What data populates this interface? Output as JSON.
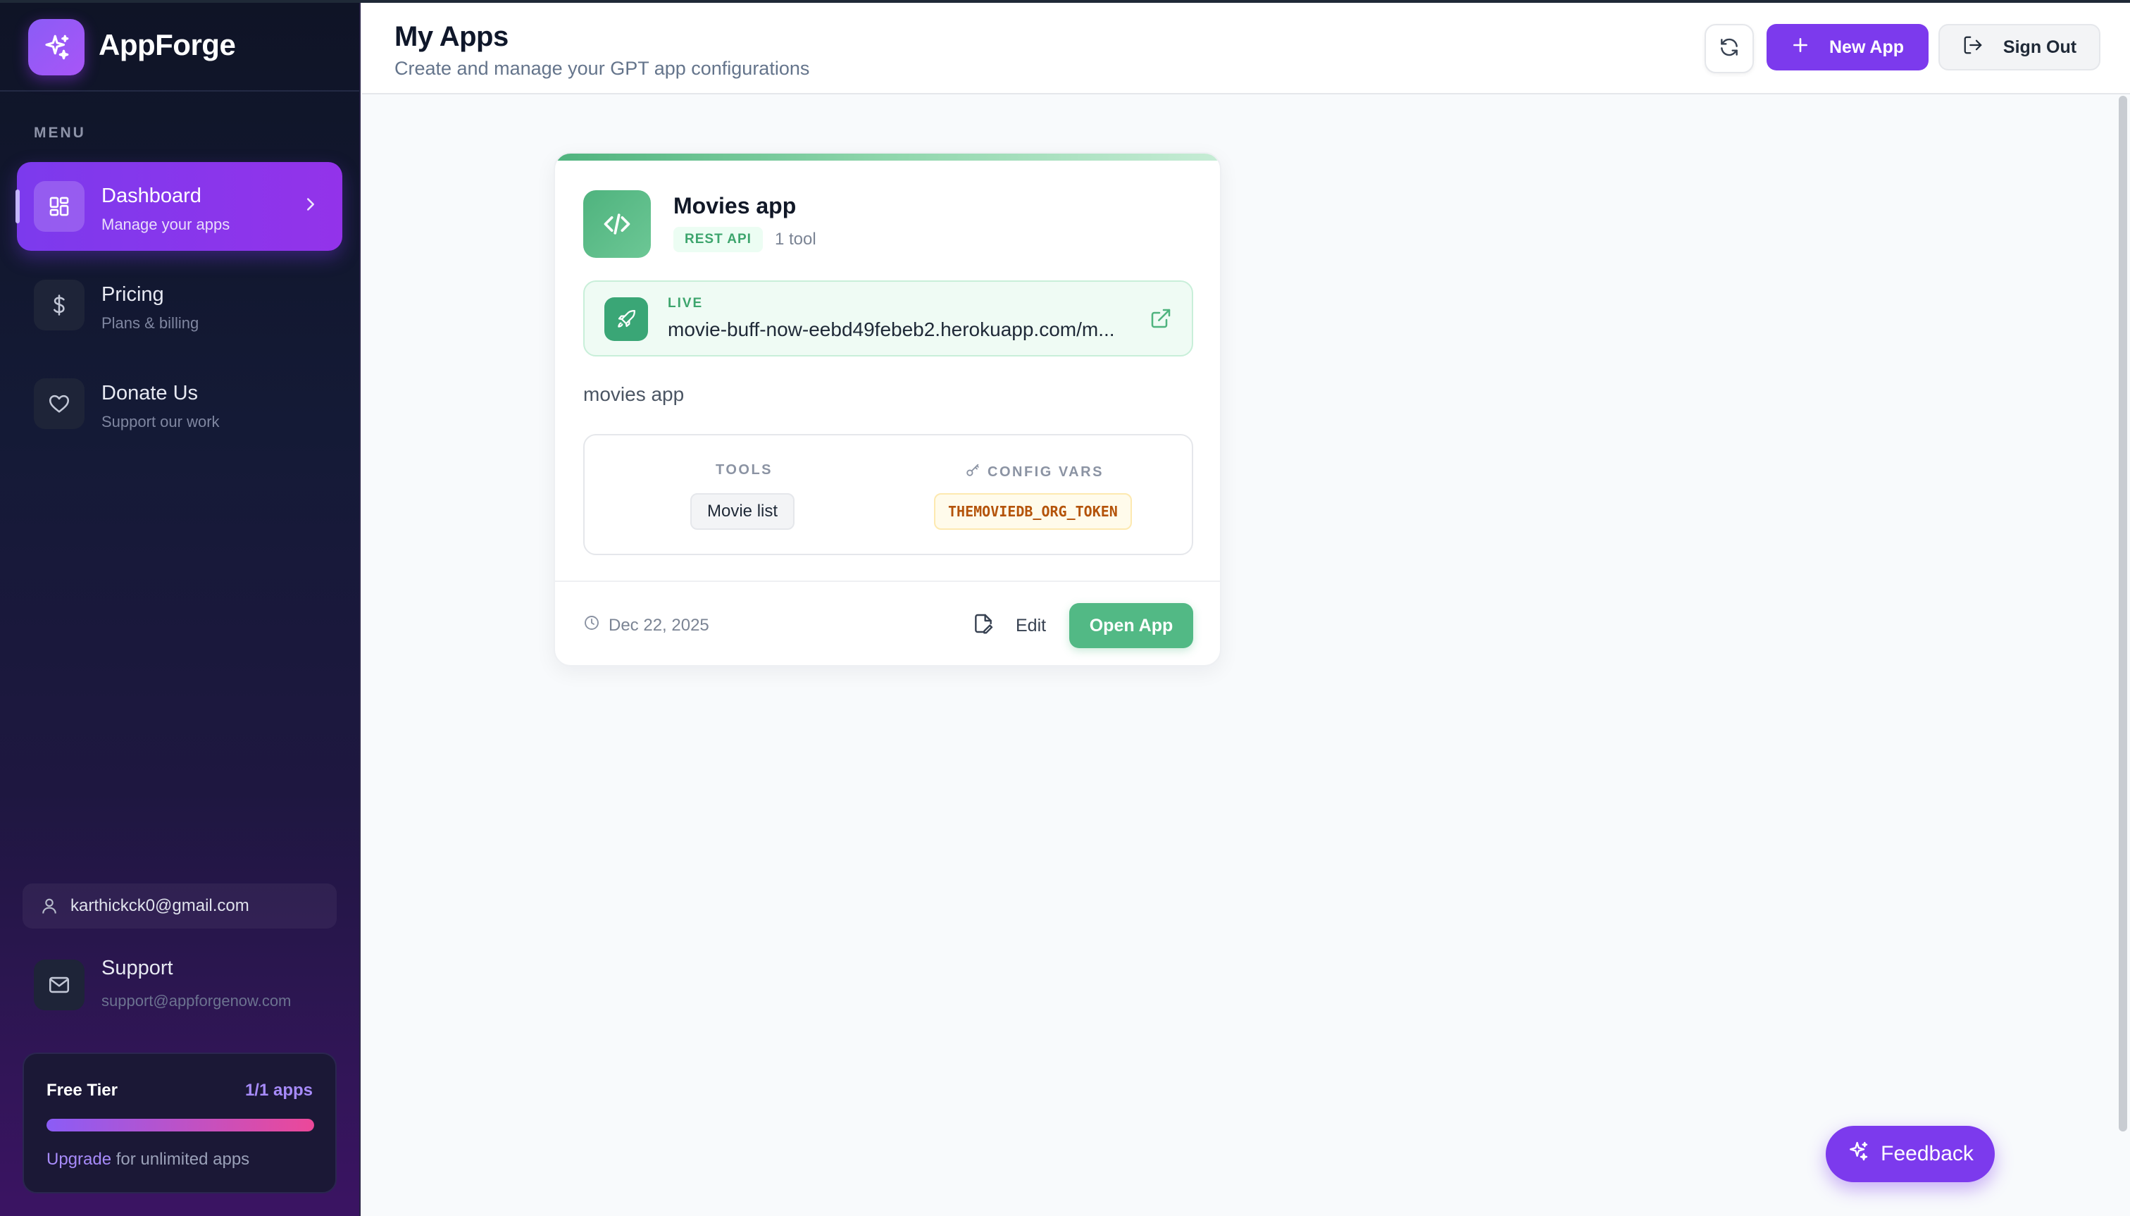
{
  "brand": {
    "name": "AppForge"
  },
  "sidebar": {
    "menu_label": "MENU",
    "items": [
      {
        "title": "Dashboard",
        "subtitle": "Manage your apps",
        "icon": "grid-icon",
        "active": true
      },
      {
        "title": "Pricing",
        "subtitle": "Plans & billing",
        "icon": "dollar-icon",
        "active": false
      },
      {
        "title": "Donate Us",
        "subtitle": "Support our work",
        "icon": "heart-icon",
        "active": false
      }
    ],
    "user_email": "karthickck0@gmail.com",
    "support": {
      "title": "Support",
      "email": "support@appforgenow.com"
    },
    "tier": {
      "name": "Free Tier",
      "count": "1/1 apps",
      "usage_fraction": 1.0,
      "upgrade_link": "Upgrade",
      "upgrade_text": " for unlimited apps"
    }
  },
  "header": {
    "title": "My Apps",
    "subtitle": "Create and manage your GPT app configurations",
    "new_app_label": "New App",
    "sign_out_label": "Sign Out"
  },
  "apps": [
    {
      "name": "Movies app",
      "type_badge": "REST API",
      "tool_count": "1 tool",
      "live_label": "LIVE",
      "url": "movie-buff-now-eebd49febeb2.herokuapp.com/m...",
      "description": "movies app",
      "tools_label": "TOOLS",
      "tools": [
        "Movie list"
      ],
      "config_label": "CONFIG VARS",
      "config_vars": [
        "THEMOVIEDB_ORG_TOKEN"
      ],
      "date": "Dec 22, 2025",
      "edit_label": "Edit",
      "open_label": "Open App"
    }
  ],
  "feedback_label": "Feedback",
  "colors": {
    "accent": "#7c3aed",
    "success": "#52b985",
    "sidebar_bg": "#0f1426"
  }
}
